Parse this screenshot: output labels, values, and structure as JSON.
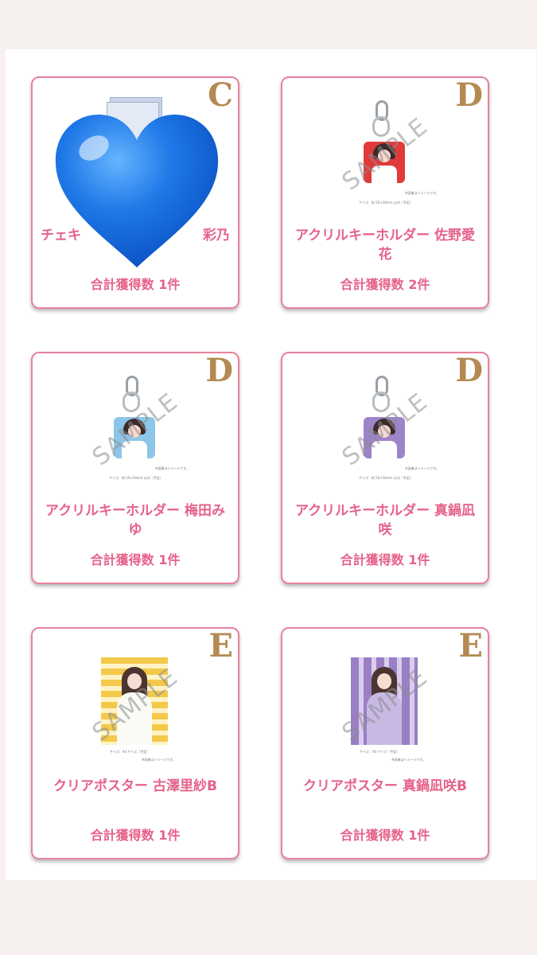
{
  "cards": [
    {
      "rank": "C",
      "name": "チェキ　　　　　　　　　彩乃",
      "count": "合計獲得数 1件"
    },
    {
      "rank": "D",
      "name": "アクリルキーホルダー 佐野愛花",
      "count": "合計獲得数 2件",
      "size_note": "サイズ：約 50×50mm 以内（予定）",
      "image_note": "※画像はイメージです。",
      "watermark": "SAMPLE",
      "plate_color": "#e03a3a"
    },
    {
      "rank": "D",
      "name": "アクリルキーホルダー 梅田みゆ",
      "count": "合計獲得数 1件",
      "size_note": "サイズ：約 50×50mm 以内（予定）",
      "image_note": "※画像はイメージです。",
      "watermark": "SAMPLE",
      "plate_color": "#8cc6e8"
    },
    {
      "rank": "D",
      "name": "アクリルキーホルダー 真鍋凪咲",
      "count": "合計獲得数 1件",
      "size_note": "サイズ：約 50×50mm 以内（予定）",
      "image_note": "※画像はイメージです。",
      "watermark": "SAMPLE",
      "plate_color": "#9d84c8"
    },
    {
      "rank": "E",
      "name": "クリアポスター 古澤里紗B",
      "count": "合計獲得数 1件",
      "size_note": "サイズ：A4 サイズ（予定）",
      "image_note": "※画像はイメージです。",
      "watermark": "SAMPLE",
      "poster_color": "#f4c94a"
    },
    {
      "rank": "E",
      "name": "クリアポスター 真鍋凪咲B",
      "count": "合計獲得数 1件",
      "size_note": "サイズ：A4 サイズ（予定）",
      "image_note": "※画像はイメージです。",
      "watermark": "SAMPLE",
      "poster_color": "#9a7fc4"
    }
  ],
  "overlay": {
    "emoji": "blue-heart-emoji",
    "color": "#1e78e6"
  },
  "colors": {
    "accent": "#e5628a",
    "border": "#e8829c",
    "rank": "#b48a52"
  }
}
